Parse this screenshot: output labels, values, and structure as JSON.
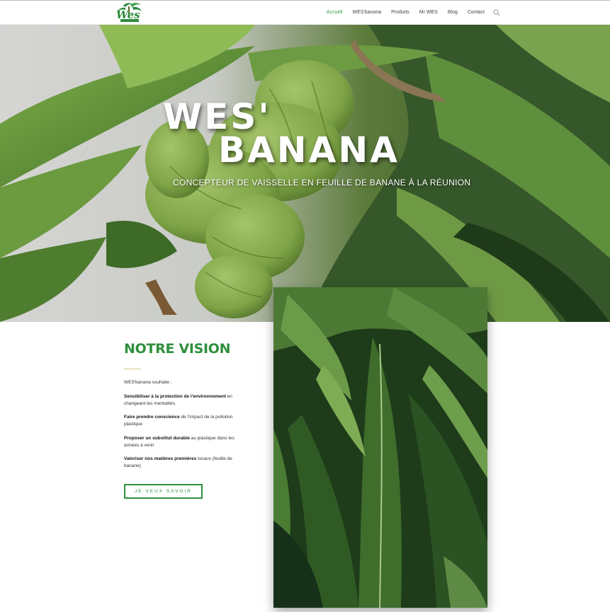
{
  "header": {
    "logo_text": "Wes",
    "nav": [
      {
        "label": "Accueil",
        "active": true
      },
      {
        "label": "WES'banana",
        "active": false
      },
      {
        "label": "Produits",
        "active": false
      },
      {
        "label": "Mr WES",
        "active": false
      },
      {
        "label": "Blog",
        "active": false
      },
      {
        "label": "Contact",
        "active": false
      }
    ],
    "search_icon": "search-icon"
  },
  "hero": {
    "title_line1": "WES'",
    "title_line2": "BANANA",
    "subtitle": "CONCEPTEUR DE VAISSELLE EN FEUILLE DE BANANE À LA RÉUNION"
  },
  "vision": {
    "title": "NOTRE VISION",
    "intro": "WES'banana souhaite :",
    "items": [
      {
        "bold": "Sensibiliser à la protection de l'environnement",
        "rest": " en changeant les mentalités."
      },
      {
        "bold": "Faire prendre conscience",
        "rest": " de l'impact de la pollution plastique"
      },
      {
        "bold": "Proposer un substitut durable",
        "rest": " au plastique dans les années à venir"
      },
      {
        "bold": "Valoriser nos matières premières",
        "rest": " locaux (feuille de banane)"
      }
    ],
    "button": "JE VEUX SAVOIR"
  },
  "colors": {
    "accent": "#2f8f3d",
    "nav_active": "#3a9a4a",
    "divider": "#d2c985"
  }
}
